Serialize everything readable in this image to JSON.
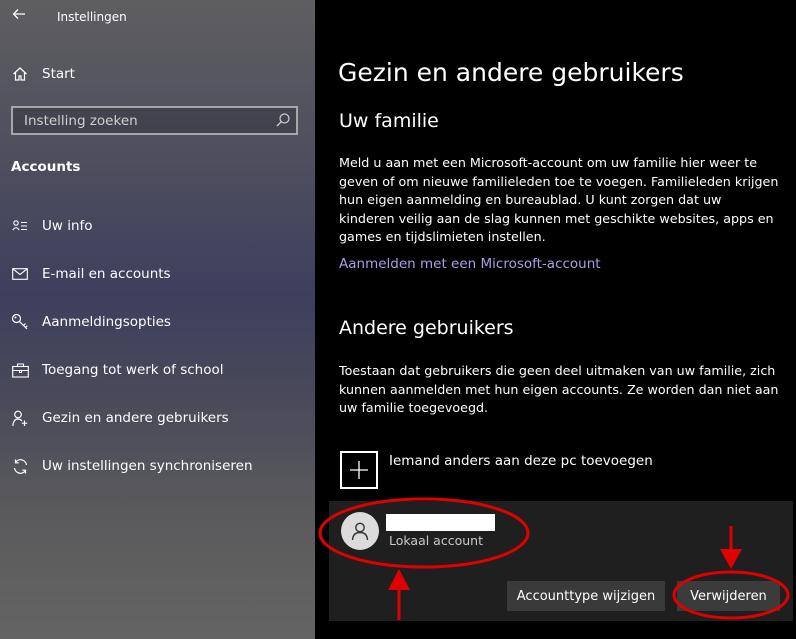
{
  "app": {
    "title": "Instellingen",
    "back_icon": "back-arrow-icon"
  },
  "sidebar": {
    "home_label": "Start",
    "search": {
      "placeholder": "Instelling zoeken",
      "value": ""
    },
    "section_heading": "Accounts",
    "items": [
      {
        "label": "Uw info",
        "icon": "user-info-icon"
      },
      {
        "label": "E-mail en accounts",
        "icon": "mail-icon"
      },
      {
        "label": "Aanmeldingsopties",
        "icon": "key-icon"
      },
      {
        "label": "Toegang tot werk of school",
        "icon": "briefcase-icon"
      },
      {
        "label": "Gezin en andere gebruikers",
        "icon": "person-add-icon"
      },
      {
        "label": "Uw instellingen synchroniseren",
        "icon": "sync-icon"
      }
    ]
  },
  "main": {
    "page_title": "Gezin en andere gebruikers",
    "family": {
      "heading": "Uw familie",
      "paragraph": "Meld u aan met een Microsoft-account om uw familie hier weer te geven of om nieuwe familieleden toe te voegen. Familieleden krijgen hun eigen aanmelding en bureaublad. U kunt zorgen dat uw kinderen veilig aan de slag kunnen met geschikte websites, apps en games en tijdslimieten instellen.",
      "link": "Aanmelden met een Microsoft-account"
    },
    "others": {
      "heading": "Andere gebruikers",
      "paragraph": "Toestaan dat gebruikers die geen deel uitmaken van uw familie, zich kunnen aanmelden met hun eigen accounts. Ze worden dan niet aan uw familie toegevoegd.",
      "add_label": "Iemand anders aan deze pc toevoegen",
      "user": {
        "account_type": "Lokaal account"
      },
      "change_button": "Accounttype wijzigen",
      "remove_button": "Verwijderen"
    }
  },
  "colors": {
    "link": "#a7a0e6",
    "annotation": "#e00000",
    "panel": "#1f1f1f",
    "button": "#3a3a3a"
  }
}
